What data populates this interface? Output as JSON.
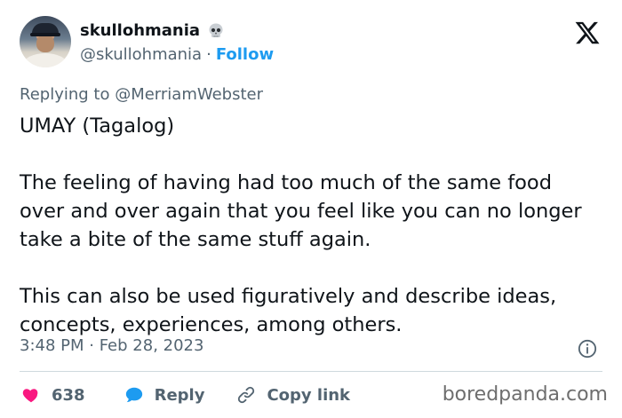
{
  "author": {
    "display_name": "skullohmania",
    "handle": "@skullohmania",
    "separator": "·",
    "follow_label": "Follow",
    "name_emoji": "skull-icon"
  },
  "replying": {
    "prefix": "Replying to ",
    "mention": "@MerriamWebster"
  },
  "tweet": {
    "lines": [
      "UMAY (Tagalog)",
      "",
      "The feeling of having had too much of the same food over and over again that you feel like you can no longer take a bite of the same stuff again.",
      "",
      "This can also be used figuratively and describe ideas, concepts, experiences, among others."
    ],
    "timestamp": "3:48 PM · Feb 28, 2023"
  },
  "actions": {
    "like_count": "638",
    "reply_label": "Reply",
    "copy_label": "Copy link"
  },
  "watermark": "boredpanda.com",
  "colors": {
    "accent": "#1d9bf0",
    "like": "#f91880",
    "muted": "#536471",
    "text": "#0f1419"
  }
}
